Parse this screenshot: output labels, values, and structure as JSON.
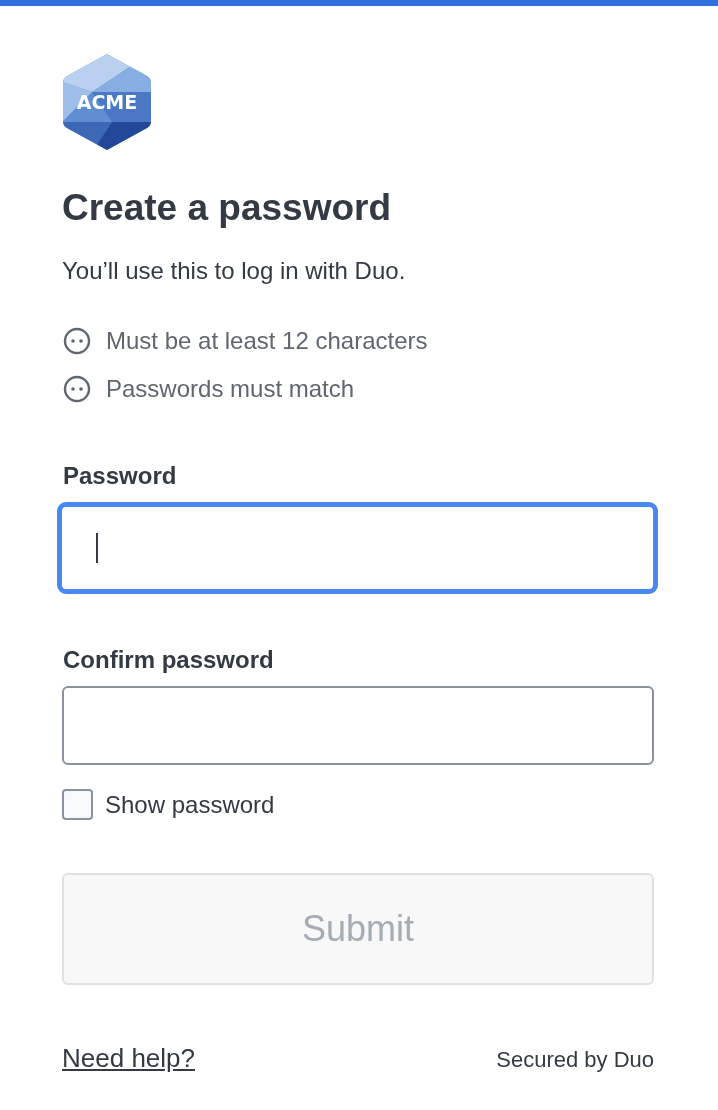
{
  "logo": {
    "text": "ACME"
  },
  "title": "Create a password",
  "subtitle": "You’ll use this to log in with Duo.",
  "requirements": [
    {
      "text": "Must be at least 12 characters",
      "met": false
    },
    {
      "text": "Passwords must match",
      "met": false
    }
  ],
  "fields": [
    {
      "label": "Password",
      "focused": true
    },
    {
      "label": "Confirm password",
      "focused": false
    }
  ],
  "show_password": {
    "label": "Show password",
    "checked": false
  },
  "submit": {
    "label": "Submit",
    "disabled": true
  },
  "footer": {
    "help_link": "Need help?",
    "secured": "Secured by Duo"
  }
}
